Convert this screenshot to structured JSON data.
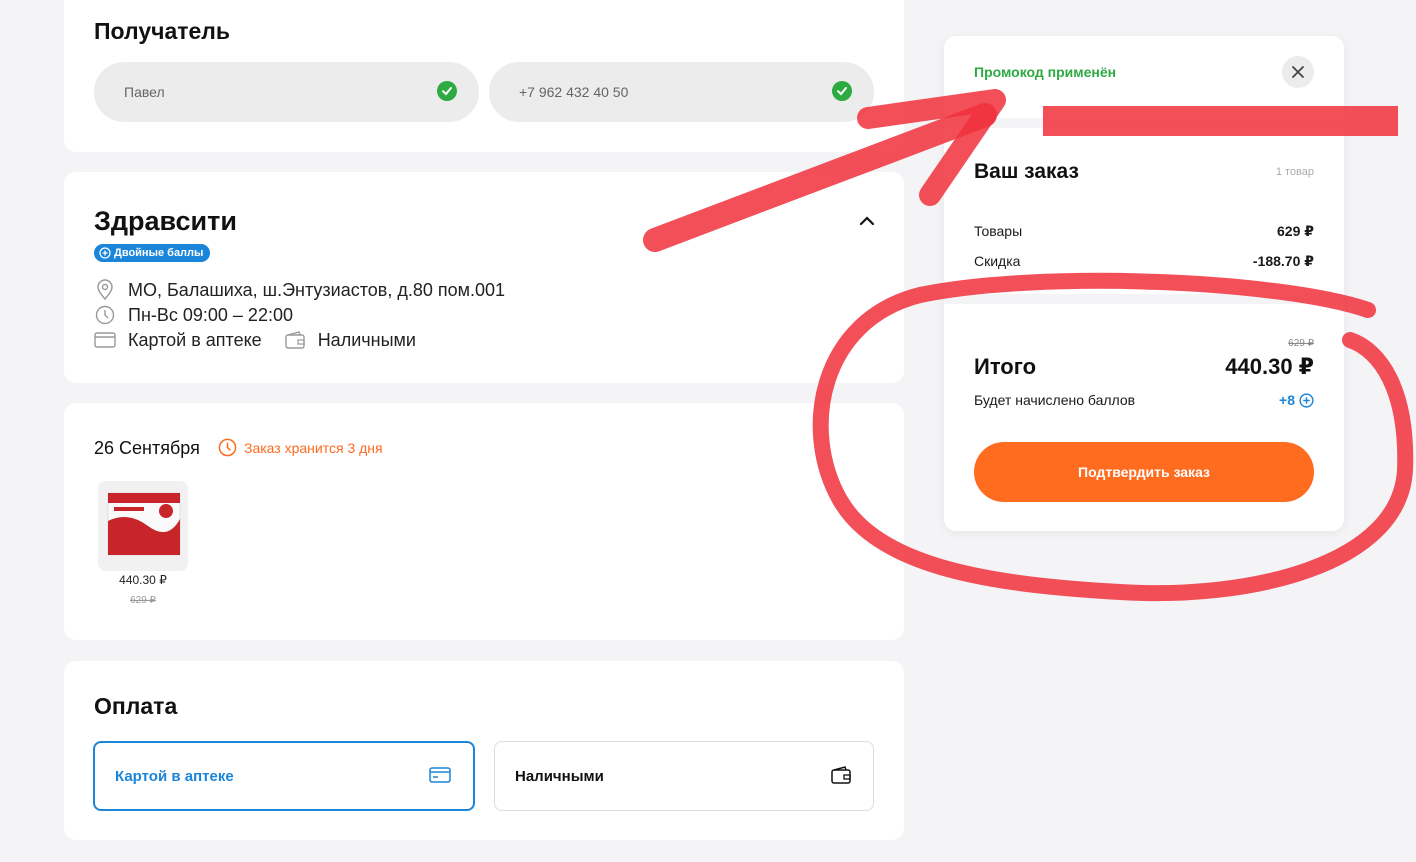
{
  "recipient": {
    "title": "Получатель",
    "name_value": "Павел",
    "phone_value": "+7 962 432 40 50"
  },
  "pharmacy": {
    "name": "Здравсити",
    "badge": "Двойные баллы",
    "address": "МО, Балашиха, ш.Энтузиастов, д.80 пом.001",
    "hours": "Пн-Вс 09:00 – 22:00",
    "payment_card": "Картой в аптеке",
    "payment_cash": "Наличными"
  },
  "delivery": {
    "date": "26 Сентября",
    "storage_note": "Заказ хранится 3 дня",
    "item": {
      "price": "440.30 ₽",
      "old_price": "629 ₽"
    }
  },
  "payment": {
    "title": "Оплата",
    "card_label": "Картой в аптеке",
    "cash_label": "Наличными"
  },
  "summary": {
    "promo_status": "Промокод применён",
    "title": "Ваш заказ",
    "count": "1 товар",
    "goods_label": "Товары",
    "goods_value": "629 ₽",
    "discount_label": "Скидка",
    "discount_value": "-188.70 ₽",
    "old_total": "629 ₽",
    "total_label": "Итого",
    "total_value": "440.30 ₽",
    "bonus_label": "Будет начислено баллов",
    "bonus_value": "+8",
    "confirm_label": "Подтвердить заказ"
  },
  "colors": {
    "accent_orange": "#ff6b1f",
    "success_green": "#2eaa43",
    "link_blue": "#1a85d9",
    "annotation_red": "#f0303c"
  }
}
